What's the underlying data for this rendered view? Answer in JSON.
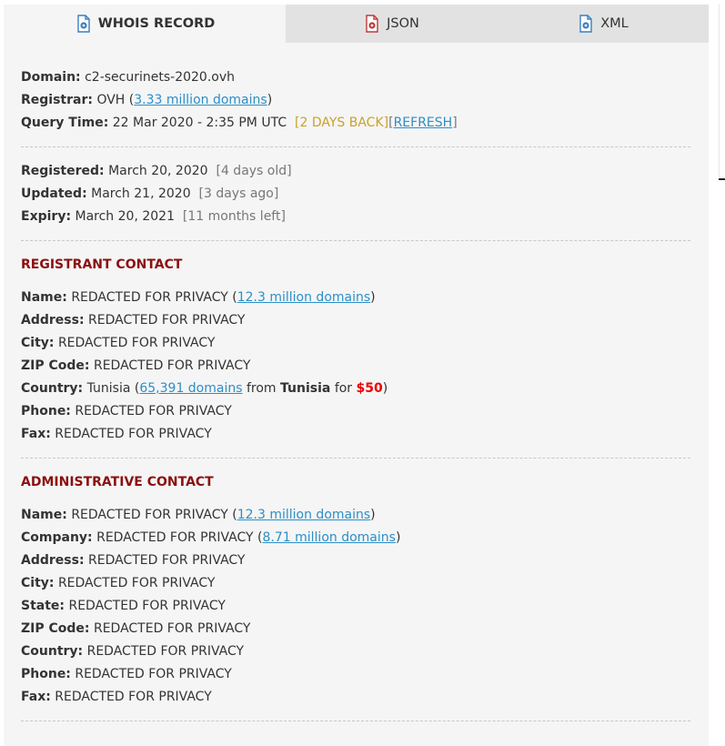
{
  "tabs": {
    "whois": "WHOIS RECORD",
    "json": "JSON",
    "xml": "XML"
  },
  "summary": {
    "domain_label": "Domain:",
    "domain_value": "c2-securinets-2020.ovh",
    "registrar_label": "Registrar:",
    "registrar_value": "OVH",
    "registrar_link": "3.33 million domains",
    "query_label": "Query Time:",
    "query_value": "22 Mar 2020 - 2:35 PM UTC",
    "days_back": "[2 DAYS BACK]",
    "refresh": "REFRESH"
  },
  "dates": {
    "registered_label": "Registered:",
    "registered_value": "March 20, 2020",
    "registered_note": "[4 days old]",
    "updated_label": "Updated:",
    "updated_value": "March 21, 2020",
    "updated_note": "[3 days ago]",
    "expiry_label": "Expiry:",
    "expiry_value": "March 20, 2021",
    "expiry_note": "[11 months left]"
  },
  "registrant": {
    "title": "REGISTRANT CONTACT",
    "name_label": "Name:",
    "name_value": "REDACTED FOR PRIVACY",
    "name_link": "12.3 million domains",
    "address_label": "Address:",
    "address_value": "REDACTED FOR PRIVACY",
    "city_label": "City:",
    "city_value": "REDACTED FOR PRIVACY",
    "zip_label": "ZIP Code:",
    "zip_value": "REDACTED FOR PRIVACY",
    "country_label": "Country:",
    "country_value": "Tunisia",
    "country_link": "65,391 domains",
    "country_from": "from",
    "country_name": "Tunisia",
    "country_for": "for",
    "price": "$50",
    "phone_label": "Phone:",
    "phone_value": "REDACTED FOR PRIVACY",
    "fax_label": "Fax:",
    "fax_value": "REDACTED FOR PRIVACY"
  },
  "admin": {
    "title": "ADMINISTRATIVE CONTACT",
    "name_label": "Name:",
    "name_value": "REDACTED FOR PRIVACY",
    "name_link": "12.3 million domains",
    "company_label": "Company:",
    "company_value": "REDACTED FOR PRIVACY",
    "company_link": "8.71 million domains",
    "address_label": "Address:",
    "address_value": "REDACTED FOR PRIVACY",
    "city_label": "City:",
    "city_value": "REDACTED FOR PRIVACY",
    "state_label": "State:",
    "state_value": "REDACTED FOR PRIVACY",
    "zip_label": "ZIP Code:",
    "zip_value": "REDACTED FOR PRIVACY",
    "country_label": "Country:",
    "country_value": "REDACTED FOR PRIVACY",
    "phone_label": "Phone:",
    "phone_value": "REDACTED FOR PRIVACY",
    "fax_label": "Fax:",
    "fax_value": "REDACTED FOR PRIVACY"
  },
  "colors": {
    "link": "#2b8fc8",
    "section_title": "#8b1010",
    "days_back": "#c9a227",
    "price": "#ee0000"
  },
  "icons": {
    "tab_icon": "document-gear-icon"
  }
}
